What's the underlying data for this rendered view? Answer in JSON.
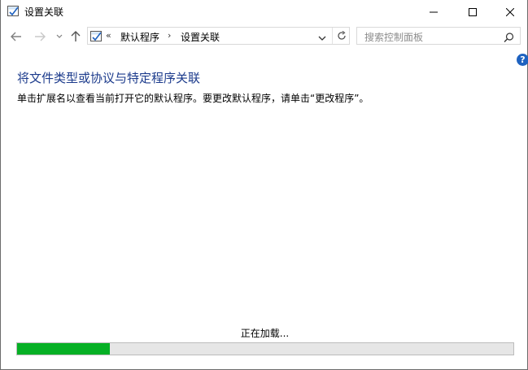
{
  "window": {
    "title": "设置关联",
    "controls": [
      "minimize-icon",
      "maximize-icon",
      "close-icon"
    ]
  },
  "nav": {
    "icons": [
      "back-arrow-icon",
      "forward-arrow-icon",
      "recent-dropdown-icon",
      "up-arrow-icon"
    ]
  },
  "address": {
    "overflow": "«",
    "breadcrumbs": [
      "默认程序",
      "设置关联"
    ],
    "separator": "›"
  },
  "search": {
    "placeholder": "搜索控制面板"
  },
  "help": {
    "label": "?"
  },
  "content": {
    "heading": "将文件类型或协议与特定程序关联",
    "description": "单击扩展名以查看当前打开它的默认程序。要更改默认程序，请单击“更改程序”。"
  },
  "status": {
    "loading_text": "正在加载...",
    "progress_fraction": 0.187
  },
  "colors": {
    "heading": "#1c3b8c",
    "progress_fill": "#06b025",
    "progress_track": "#e6e6e6",
    "help_badge": "#1e62c0"
  }
}
